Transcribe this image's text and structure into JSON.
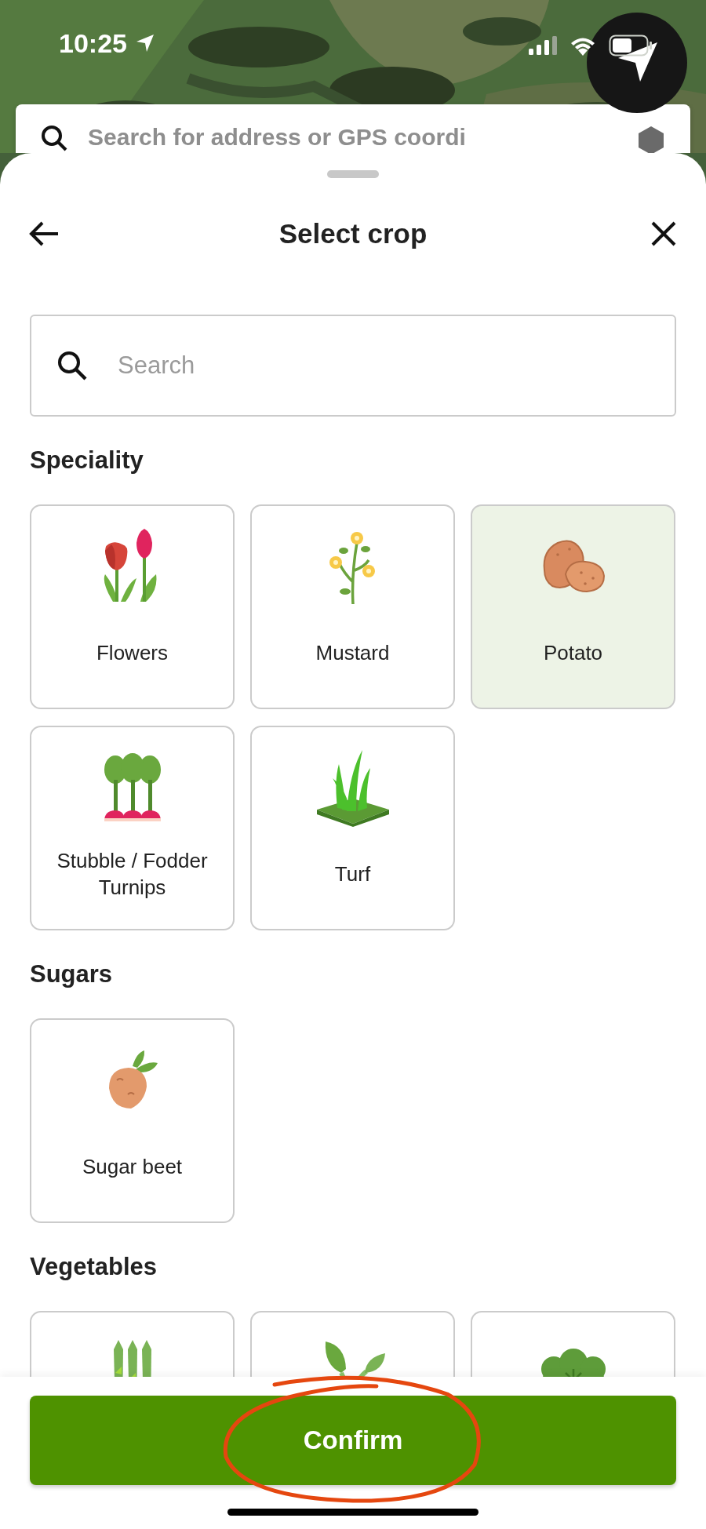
{
  "status_bar": {
    "time": "10:25"
  },
  "map": {
    "search_placeholder": "Search for address or GPS coordi"
  },
  "sheet": {
    "title": "Select crop"
  },
  "search": {
    "placeholder": "Search"
  },
  "sections": [
    {
      "title": "Speciality",
      "items": [
        {
          "label": "Flowers",
          "selected": false
        },
        {
          "label": "Mustard",
          "selected": false
        },
        {
          "label": "Potato",
          "selected": true
        },
        {
          "label": "Stubble / Fodder Turnips",
          "selected": false
        },
        {
          "label": "Turf",
          "selected": false
        }
      ]
    },
    {
      "title": "Sugars",
      "items": [
        {
          "label": "Sugar beet",
          "selected": false
        }
      ]
    },
    {
      "title": "Vegetables",
      "items": [
        {
          "selected": false
        },
        {
          "selected": false
        },
        {
          "selected": false
        }
      ]
    }
  ],
  "confirm": {
    "label": "Confirm",
    "highlighted": true
  }
}
